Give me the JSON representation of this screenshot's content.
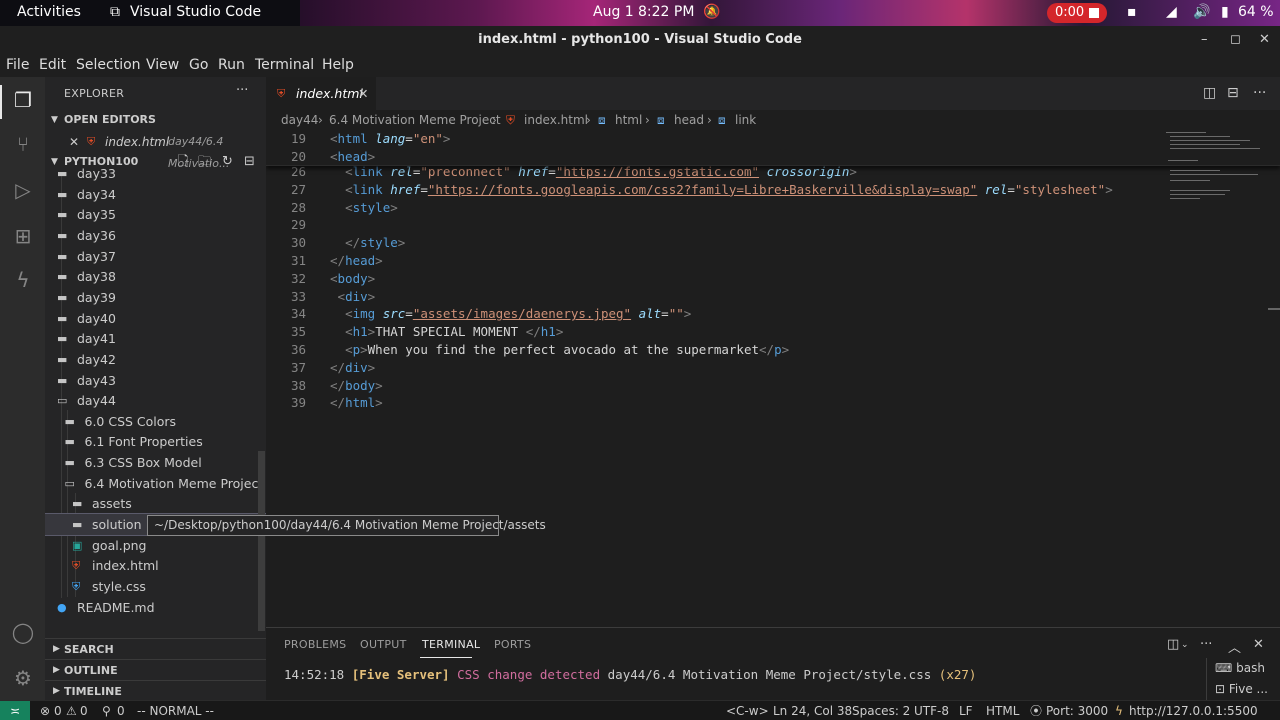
{
  "system_bar": {
    "activities": "Activities",
    "app_name": "Visual Studio Code",
    "date": "Aug 1",
    "time": "8:22 PM",
    "recording_time": "0:00",
    "battery": "64 %"
  },
  "window": {
    "title": "index.html - python100 - Visual Studio Code"
  },
  "menu": [
    "File",
    "Edit",
    "Selection",
    "View",
    "Go",
    "Run",
    "Terminal",
    "Help"
  ],
  "sidebar": {
    "title": "EXPLORER",
    "more": "···",
    "open_editors_label": "OPEN EDITORS",
    "open_editor": {
      "name": "index.html",
      "path": "day44/6.4 Motivatio..."
    },
    "workspace_label": "PYTHON100",
    "tree": [
      {
        "label": "day33",
        "kind": "folder"
      },
      {
        "label": "day34",
        "kind": "folder"
      },
      {
        "label": "day35",
        "kind": "folder"
      },
      {
        "label": "day36",
        "kind": "folder"
      },
      {
        "label": "day37",
        "kind": "folder"
      },
      {
        "label": "day38",
        "kind": "folder"
      },
      {
        "label": "day39",
        "kind": "folder"
      },
      {
        "label": "day40",
        "kind": "folder"
      },
      {
        "label": "day41",
        "kind": "folder"
      },
      {
        "label": "day42",
        "kind": "folder"
      },
      {
        "label": "day43",
        "kind": "folder"
      },
      {
        "label": "day44",
        "kind": "folder-open"
      },
      {
        "label": "6.0 CSS Colors",
        "kind": "folder"
      },
      {
        "label": "6.1 Font Properties",
        "kind": "folder"
      },
      {
        "label": "6.3 CSS Box Model",
        "kind": "folder"
      },
      {
        "label": "6.4 Motivation Meme Project",
        "kind": "folder-open"
      },
      {
        "label": "assets",
        "kind": "folder"
      },
      {
        "label": "solution",
        "kind": "folder"
      },
      {
        "label": "goal.png",
        "kind": "image"
      },
      {
        "label": "index.html",
        "kind": "html"
      },
      {
        "label": "style.css",
        "kind": "css"
      },
      {
        "label": "README.md",
        "kind": "info"
      }
    ],
    "bottom_sections": [
      "SEARCH",
      "OUTLINE",
      "TIMELINE"
    ]
  },
  "tooltip": "~/Desktop/python100/day44/6.4 Motivation Meme Project/assets",
  "editor": {
    "tab_name": "index.html",
    "breadcrumb": [
      "day44",
      "6.4 Motivation Meme Project",
      "index.html",
      "html",
      "head",
      "link"
    ],
    "sticky_lines": [
      {
        "n": "19",
        "parts": [
          [
            "tag",
            "<"
          ],
          [
            "tn",
            "html"
          ],
          [
            "tx",
            " "
          ],
          [
            "at",
            "lang"
          ],
          [
            "tx",
            "="
          ],
          [
            "av",
            "\"en\""
          ],
          [
            "tag",
            ">"
          ]
        ]
      },
      {
        "n": "20",
        "parts": [
          [
            "tag",
            "<"
          ],
          [
            "tn",
            "head"
          ],
          [
            "tag",
            ">"
          ]
        ]
      }
    ],
    "lines": [
      {
        "n": "26",
        "parts": [
          [
            "tx",
            "  "
          ],
          [
            "tag",
            "<"
          ],
          [
            "tn",
            "link"
          ],
          [
            "tx",
            " "
          ],
          [
            "at",
            "rel"
          ],
          [
            "tx",
            "="
          ],
          [
            "av",
            "\"preconnect\""
          ],
          [
            "tx",
            " "
          ],
          [
            "at",
            "href"
          ],
          [
            "tx",
            "="
          ],
          [
            "av",
            "\"https://fonts.gstatic.com\""
          ],
          [
            "tx",
            " "
          ],
          [
            "at",
            "crossorigin"
          ],
          [
            "tag",
            ">"
          ]
        ]
      },
      {
        "n": "27",
        "parts": [
          [
            "tx",
            "  "
          ],
          [
            "tag",
            "<"
          ],
          [
            "tn",
            "link"
          ],
          [
            "tx",
            " "
          ],
          [
            "at",
            "href"
          ],
          [
            "tx",
            "="
          ],
          [
            "av",
            "\"https://fonts.googleapis.com/css2?family=Libre+Baskerville&display=swap\""
          ],
          [
            "tx",
            " "
          ],
          [
            "at",
            "rel"
          ],
          [
            "tx",
            "="
          ],
          [
            "av",
            "\"stylesheet\""
          ],
          [
            "tag",
            ">"
          ]
        ]
      },
      {
        "n": "28",
        "parts": [
          [
            "tx",
            "  "
          ],
          [
            "tag",
            "<"
          ],
          [
            "tn",
            "style"
          ],
          [
            "tag",
            ">"
          ]
        ]
      },
      {
        "n": "29",
        "parts": [
          [
            "tx",
            ""
          ]
        ]
      },
      {
        "n": "30",
        "parts": [
          [
            "tx",
            "  "
          ],
          [
            "tag",
            "</"
          ],
          [
            "tn",
            "style"
          ],
          [
            "tag",
            ">"
          ]
        ]
      },
      {
        "n": "31",
        "parts": [
          [
            "tag",
            "</"
          ],
          [
            "tn",
            "head"
          ],
          [
            "tag",
            ">"
          ]
        ]
      },
      {
        "n": "32",
        "parts": [
          [
            "tag",
            "<"
          ],
          [
            "tn",
            "body"
          ],
          [
            "tag",
            ">"
          ]
        ]
      },
      {
        "n": "33",
        "parts": [
          [
            "tx",
            " "
          ],
          [
            "tag",
            "<"
          ],
          [
            "tn",
            "div"
          ],
          [
            "tag",
            ">"
          ]
        ]
      },
      {
        "n": "34",
        "parts": [
          [
            "tx",
            "  "
          ],
          [
            "tag",
            "<"
          ],
          [
            "tn",
            "img"
          ],
          [
            "tx",
            " "
          ],
          [
            "at",
            "src"
          ],
          [
            "tx",
            "="
          ],
          [
            "av",
            "\"assets/images/daenerys.jpeg\""
          ],
          [
            "tx",
            " "
          ],
          [
            "at",
            "alt"
          ],
          [
            "tx",
            "="
          ],
          [
            "av",
            "\"\""
          ],
          [
            "tag",
            ">"
          ]
        ]
      },
      {
        "n": "35",
        "parts": [
          [
            "tx",
            "  "
          ],
          [
            "tag",
            "<"
          ],
          [
            "tn",
            "h1"
          ],
          [
            "tag",
            ">"
          ],
          [
            "tx",
            "THAT SPECIAL MOMENT "
          ],
          [
            "tag",
            "</"
          ],
          [
            "tn",
            "h1"
          ],
          [
            "tag",
            ">"
          ]
        ]
      },
      {
        "n": "36",
        "parts": [
          [
            "tx",
            "  "
          ],
          [
            "tag",
            "<"
          ],
          [
            "tn",
            "p"
          ],
          [
            "tag",
            ">"
          ],
          [
            "tx",
            "When you find the perfect avocado at the supermarket"
          ],
          [
            "tag",
            "</"
          ],
          [
            "tn",
            "p"
          ],
          [
            "tag",
            ">"
          ]
        ]
      },
      {
        "n": "37",
        "parts": [
          [
            "tag",
            "</"
          ],
          [
            "tn",
            "div"
          ],
          [
            "tag",
            ">"
          ]
        ]
      },
      {
        "n": "38",
        "parts": [
          [
            "tag",
            "</"
          ],
          [
            "tn",
            "body"
          ],
          [
            "tag",
            ">"
          ]
        ]
      },
      {
        "n": "39",
        "parts": [
          [
            "tag",
            "</"
          ],
          [
            "tn",
            "html"
          ],
          [
            "tag",
            ">"
          ]
        ]
      }
    ]
  },
  "panel": {
    "tabs": [
      "PROBLEMS",
      "OUTPUT",
      "TERMINAL",
      "PORTS"
    ],
    "active_tab": "TERMINAL",
    "terminal_line": {
      "time": "14:52:18",
      "server": "[Five Server]",
      "message": "CSS change detected",
      "path": "day44/6.4 Motivation Meme Project/style.css",
      "count": "(x27)"
    },
    "terminals": [
      "bash",
      "Five ..."
    ]
  },
  "status": {
    "errors": "0",
    "warnings": "0",
    "ports": "0",
    "vim_mode": "-- NORMAL --",
    "keybinding": "<C-w>",
    "position": "Ln 24, Col 38",
    "spaces": "Spaces: 2",
    "encoding": "UTF-8",
    "eol": "LF",
    "language": "HTML",
    "port": "Port: 3000",
    "url": "http://127.0.0.1:5500"
  },
  "colors": {
    "accent": "#007acc",
    "html_icon": "#e44d26",
    "css_icon": "#42a5f5",
    "recording": "#d4262b"
  }
}
